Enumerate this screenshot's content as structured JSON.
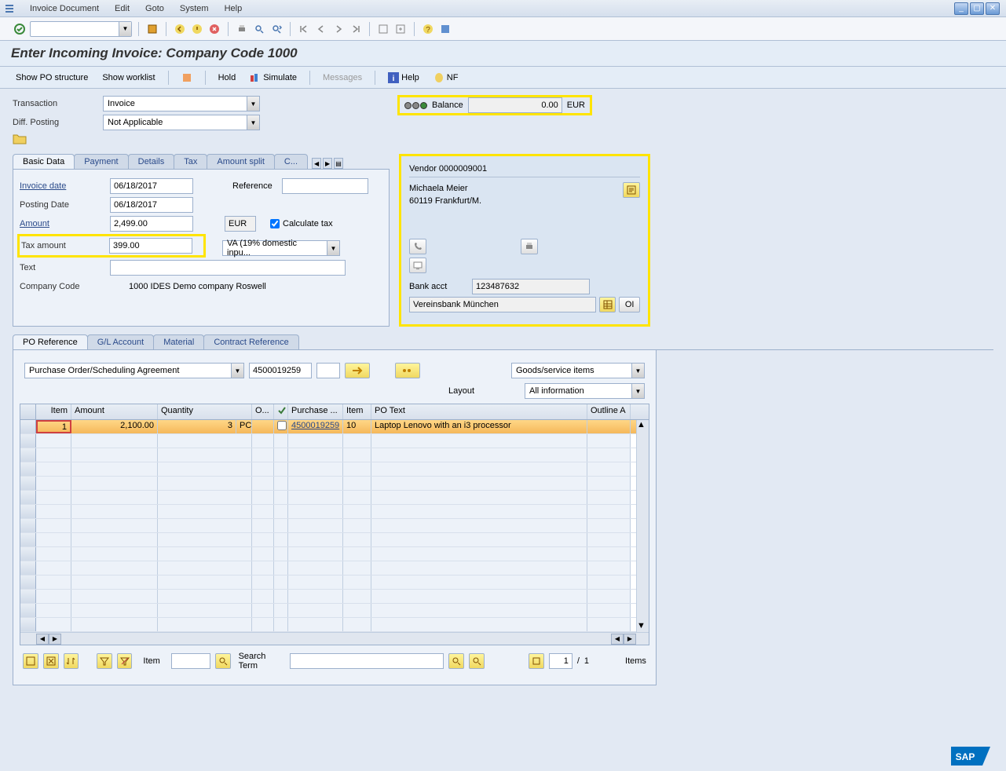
{
  "menubar": {
    "items": [
      "Invoice Document",
      "Edit",
      "Goto",
      "System",
      "Help"
    ]
  },
  "page_title": "Enter Incoming Invoice: Company Code 1000",
  "app_toolbar": {
    "show_po_structure": "Show PO structure",
    "show_worklist": "Show worklist",
    "hold": "Hold",
    "simulate": "Simulate",
    "messages": "Messages",
    "help": "Help",
    "nf": "NF"
  },
  "transaction": {
    "label": "Transaction",
    "value": "Invoice"
  },
  "diff_posting": {
    "label": "Diff. Posting",
    "value": "Not Applicable"
  },
  "balance": {
    "label": "Balance",
    "value": "0.00",
    "currency": "EUR"
  },
  "basic_tabs": [
    "Basic Data",
    "Payment",
    "Details",
    "Tax",
    "Amount split",
    "C..."
  ],
  "basic_data": {
    "invoice_date": {
      "label": "Invoice date",
      "value": "06/18/2017"
    },
    "posting_date": {
      "label": "Posting Date",
      "value": "06/18/2017"
    },
    "reference": {
      "label": "Reference",
      "value": ""
    },
    "amount": {
      "label": "Amount",
      "value": "2,499.00",
      "currency": "EUR"
    },
    "calc_tax_label": "Calculate tax",
    "tax_amount": {
      "label": "Tax amount",
      "value": "399.00"
    },
    "tax_code": "VA (19% domestic inpu...",
    "text": {
      "label": "Text",
      "value": ""
    },
    "company_code": {
      "label": "Company Code",
      "value": "1000 IDES Demo company Roswell"
    }
  },
  "vendor": {
    "header": "Vendor 0000009001",
    "name": "Michaela Meier",
    "city": "60119 Frankfurt/M.",
    "bank_acct_label": "Bank acct",
    "bank_acct": "123487632",
    "bank_name": "Vereinsbank München",
    "oi_btn": "OI"
  },
  "lower_tabs": [
    "PO Reference",
    "G/L Account",
    "Material",
    "Contract Reference"
  ],
  "po_reference": {
    "po_type": "Purchase Order/Scheduling Agreement",
    "po_number": "4500019259",
    "goods_filter": "Goods/service items",
    "layout_label": "Layout",
    "layout_value": "All information"
  },
  "grid": {
    "columns": [
      "Item",
      "Amount",
      "Quantity",
      "O...",
      "",
      "Purchase ...",
      "Item",
      "PO Text",
      "Outline A"
    ],
    "rows": [
      {
        "item": "1",
        "amount": "2,100.00",
        "qty": "3",
        "unit": "PC",
        "po": "4500019259",
        "po_item": "10",
        "po_text": "Laptop Lenovo with an i3 processor"
      }
    ]
  },
  "bottom": {
    "item_label": "Item",
    "search_term_label": "Search Term",
    "page": "1",
    "page_sep": "/",
    "page_total": "1",
    "items_label": "Items"
  }
}
